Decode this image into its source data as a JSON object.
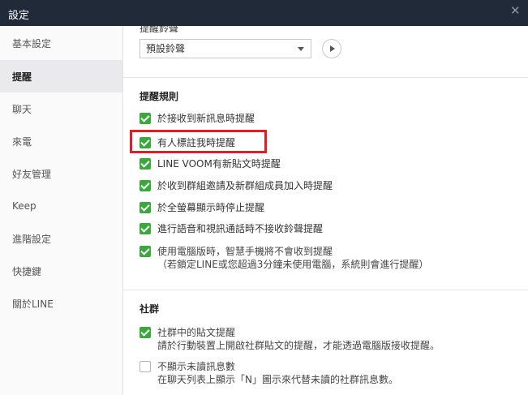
{
  "window": {
    "title": "設定",
    "close_icon": "close-icon"
  },
  "sidebar": {
    "items": [
      {
        "label": "基本設定",
        "active": false
      },
      {
        "label": "提醒",
        "active": true
      },
      {
        "label": "聊天",
        "active": false
      },
      {
        "label": "來電",
        "active": false
      },
      {
        "label": "好友管理",
        "active": false
      },
      {
        "label": "Keep",
        "active": false
      },
      {
        "label": "進階設定",
        "active": false
      },
      {
        "label": "快捷鍵",
        "active": false
      },
      {
        "label": "關於LINE",
        "active": false
      }
    ]
  },
  "sound": {
    "partial_label": "提醒鈴聲",
    "select_value": "預設鈴聲"
  },
  "rules": {
    "title": "提醒規則",
    "options": [
      {
        "label": "於接收到新訊息時提醒",
        "checked": true
      },
      {
        "label": "有人標註我時提醒",
        "checked": true
      },
      {
        "label": "LINE VOOM有新貼文時提醒",
        "checked": true
      },
      {
        "label": "於收到群組邀請及新群組成員加入時提醒",
        "checked": true
      },
      {
        "label": "於全螢幕顯示時停止提醒",
        "checked": true
      },
      {
        "label": "進行語音和視訊通話時不接收鈴聲提醒",
        "checked": true
      },
      {
        "label": "使用電腦版時，智慧手機將不會收到提醒",
        "sub": "（若鎖定LINE或您超過3分鐘未使用電腦，系統則會進行提醒）",
        "checked": true
      }
    ]
  },
  "community": {
    "title": "社群",
    "options": [
      {
        "label": "社群中的貼文提醒",
        "sub": "請於行動裝置上開啟社群貼文的提醒，才能透過電腦版接收提醒。",
        "checked": true
      },
      {
        "label": "不顯示未讀訊息數",
        "sub": "在聊天列表上顯示「N」圖示來代替未讀的社群訊息數。",
        "checked": false
      }
    ]
  },
  "colors": {
    "titlebar": "#202a38",
    "check": "#3aa93c",
    "highlight": "#e01e27"
  }
}
